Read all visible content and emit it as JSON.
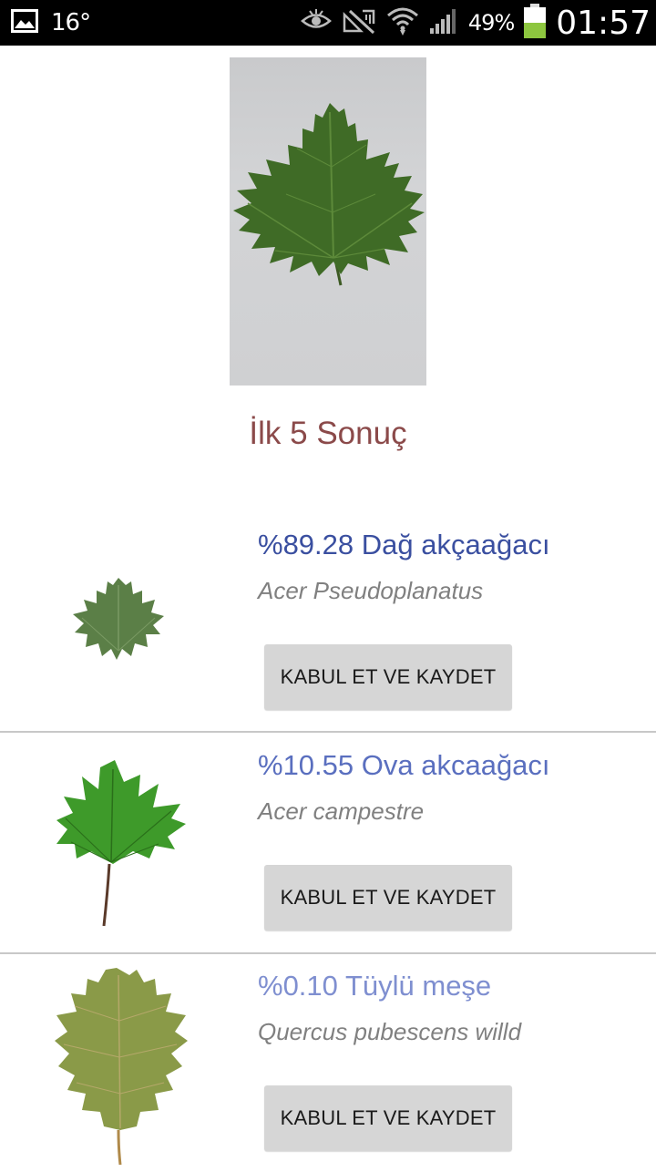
{
  "status_bar": {
    "temperature": "16°",
    "battery_percent": "49%",
    "time": "01:57",
    "battery_level": 0.49,
    "battery_color": "#8dc63f",
    "icons": [
      "gallery-icon",
      "eye-icon",
      "mute-icon",
      "wifi-icon",
      "signal-icon",
      "battery-icon"
    ]
  },
  "results_title": "İlk 5 Sonuç",
  "results": [
    {
      "name": "%89.28 Dağ akçaağacı",
      "latin": "Acer Pseudoplanatus",
      "button_label": "KABUL ET VE KAYDET",
      "name_color": "#3a4fa0"
    },
    {
      "name": "%10.55 Ova akcaağacı",
      "latin": "Acer campestre",
      "button_label": "KABUL ET VE KAYDET",
      "name_color": "#5a6fbf"
    },
    {
      "name": "%0.10 Tüylü meşe",
      "latin": "Quercus pubescens willd",
      "button_label": "KABUL ET VE KAYDET",
      "name_color": "#7f8fd0"
    }
  ]
}
